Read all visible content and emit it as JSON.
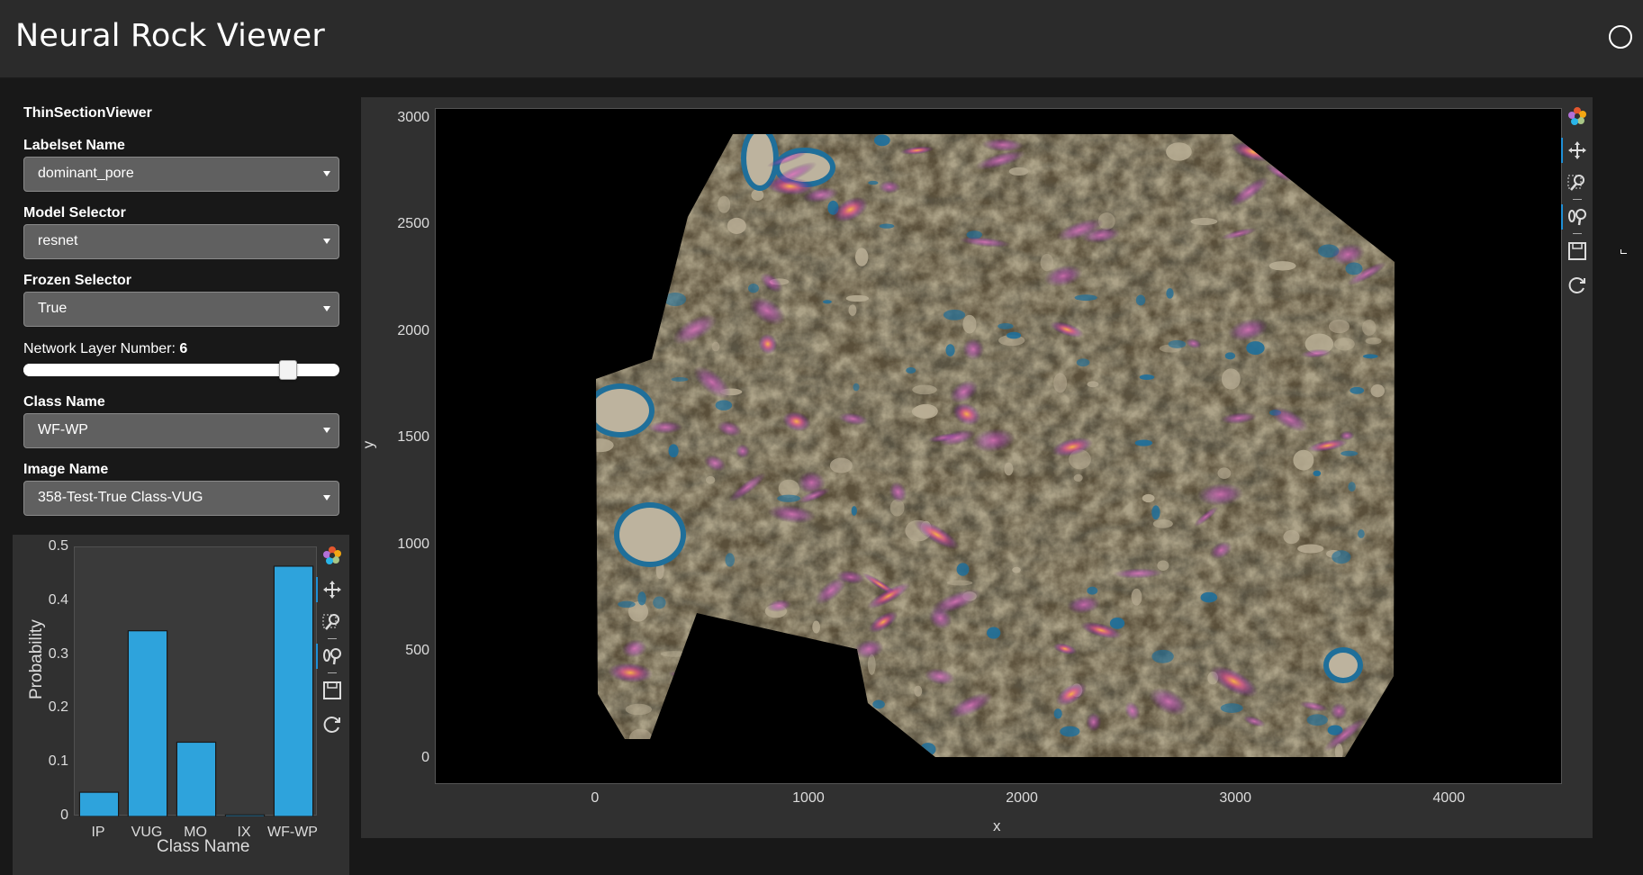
{
  "app": {
    "title": "Neural Rock Viewer"
  },
  "sidebar": {
    "widget_title": "ThinSectionViewer",
    "labelset": {
      "label": "Labelset Name",
      "value": "dominant_pore"
    },
    "model": {
      "label": "Model Selector",
      "value": "resnet"
    },
    "frozen": {
      "label": "Frozen Selector",
      "value": "True"
    },
    "layer": {
      "label": "Network Layer Number:",
      "value": "6",
      "fraction": 0.857
    },
    "class_name": {
      "label": "Class Name",
      "value": "WF-WP"
    },
    "image_name": {
      "label": "Image Name",
      "value": "358-Test-True Class-VUG"
    }
  },
  "chart_data": [
    {
      "type": "bar",
      "categories": [
        "IP",
        "VUG",
        "MO",
        "IX",
        "WF-WP"
      ],
      "values": [
        0.045,
        0.345,
        0.138,
        0.003,
        0.465
      ],
      "xlabel": "Class Name",
      "ylabel": "Probability",
      "ylim": [
        0,
        0.5
      ],
      "yticks": [
        "0",
        "0.1",
        "0.2",
        "0.3",
        "0.4",
        "0.5"
      ],
      "bar_color": "#2ea3dc",
      "grid": false
    },
    {
      "type": "heatmap",
      "xlabel": "x",
      "ylabel": "y",
      "xlim": [
        -750,
        4530
      ],
      "ylim": [
        -120,
        3050
      ],
      "xticks": [
        "0",
        "1000",
        "2000",
        "3000",
        "4000"
      ],
      "yticks": [
        "0",
        "500",
        "1000",
        "1500",
        "2000",
        "2500",
        "3000"
      ],
      "xtick_values": [
        0,
        1000,
        2000,
        3000,
        4000
      ],
      "ytick_values": [
        0,
        500,
        1000,
        1500,
        2000,
        2500,
        3000
      ],
      "background": "#000000",
      "overlay_colormap": "inferno"
    }
  ],
  "toolbar_icons": [
    "bokeh-logo-icon",
    "pan-icon",
    "box-zoom-icon",
    "wheel-zoom-icon",
    "save-icon",
    "reset-icon"
  ],
  "colors": {
    "header_bg": "#2b2b2b",
    "panel_bg": "#303030",
    "accent": "#1f8fd6",
    "bar": "#2ea3dc"
  }
}
